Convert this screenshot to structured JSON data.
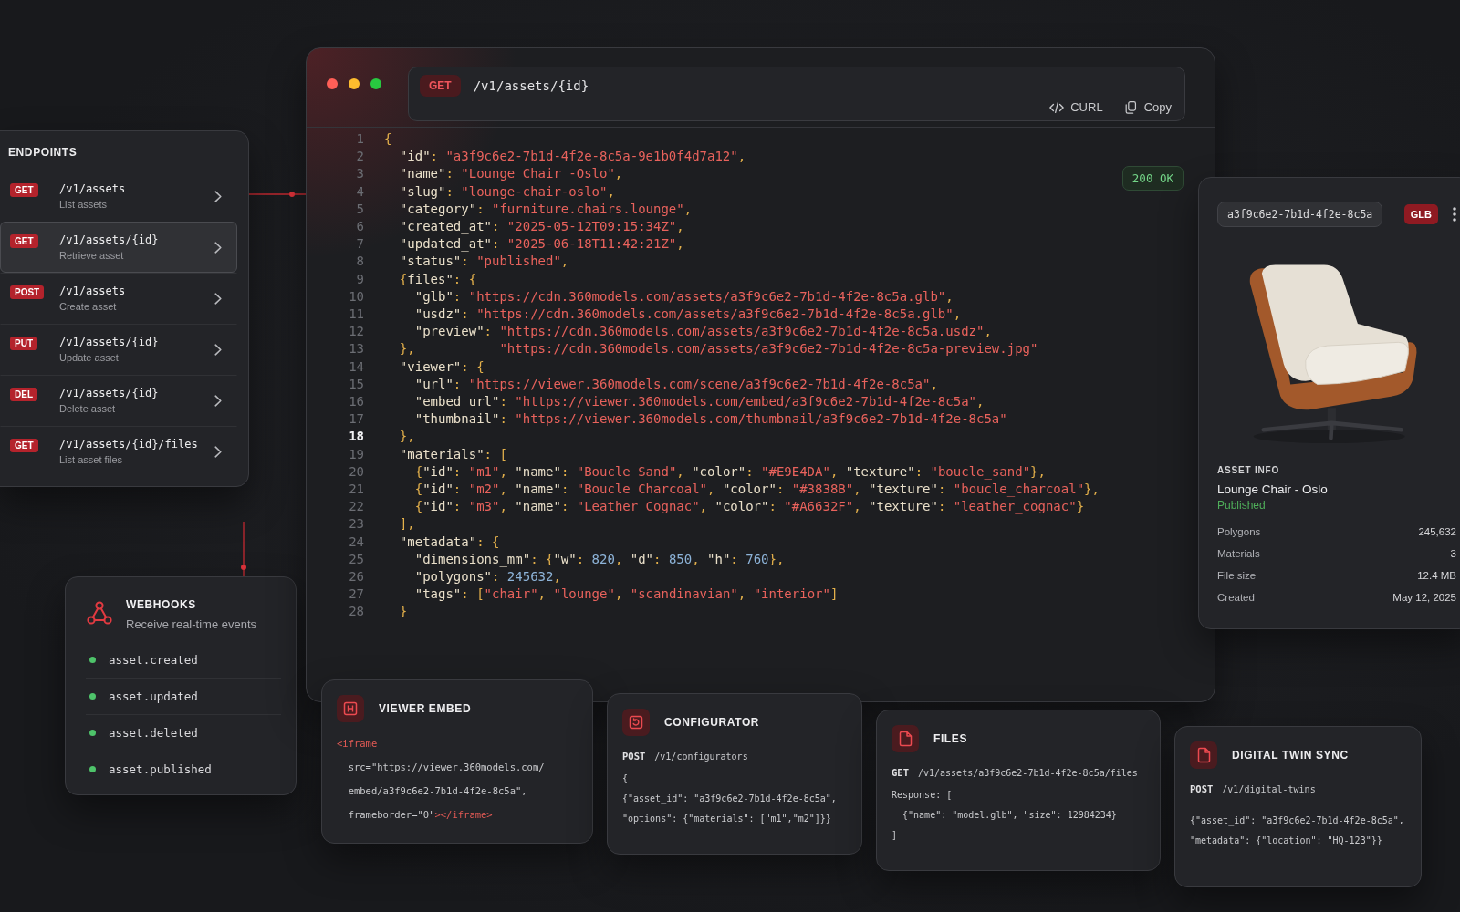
{
  "endpoints": {
    "title": "ENDPOINTS",
    "items": [
      {
        "method": "GET",
        "path": "/v1/assets",
        "description": "List assets",
        "selected": false
      },
      {
        "method": "GET",
        "path": "/v1/assets/{id}",
        "description": "Retrieve asset",
        "selected": true
      },
      {
        "method": "POST",
        "path": "/v1/assets",
        "description": "Create asset",
        "selected": false
      },
      {
        "method": "PUT",
        "path": "/v1/assets/{id}",
        "description": "Update asset",
        "selected": false
      },
      {
        "method": "DEL",
        "path": "/v1/assets/{id}",
        "description": "Delete asset",
        "selected": false
      },
      {
        "method": "GET",
        "path": "/v1/assets/{id}/files",
        "description": "List asset files",
        "selected": false
      }
    ]
  },
  "webhooks": {
    "title": "WEBHOOKS",
    "subtitle": "Receive real-time events",
    "events": [
      "asset.created",
      "asset.updated",
      "asset.deleted",
      "asset.published"
    ]
  },
  "request": {
    "method": "GET",
    "path": "/v1/assets/{id}",
    "actions": [
      {
        "kind": "curl",
        "label": "CURL"
      },
      {
        "kind": "copy",
        "label": "Copy"
      }
    ],
    "status": "200 OK",
    "lines": [
      {
        "number": "1",
        "selected": false,
        "tokens": [
          {
            "kind": "punct",
            "text": "{"
          }
        ],
        "children": [
          {
            "number": "2",
            "selected": false,
            "tokens": [
              {
                "kind": "key",
                "text": "\"id\""
              },
              {
                "kind": "punct",
                "text": ": "
              },
              {
                "kind": "string",
                "text": "\"a3f9c6e2-7b1d-4f2e-8c5a-9e1b0f4d7a12\""
              },
              {
                "kind": "punct",
                "text": ","
              }
            ]
          },
          {
            "number": "3",
            "selected": false,
            "tokens": [
              {
                "kind": "key",
                "text": "\"name\""
              },
              {
                "kind": "punct",
                "text": ": "
              },
              {
                "kind": "string",
                "text": "\"Lounge Chair -Oslo\""
              },
              {
                "kind": "punct",
                "text": ","
              }
            ]
          },
          {
            "number": "4",
            "selected": false,
            "tokens": [
              {
                "kind": "key",
                "text": "\"slug\""
              },
              {
                "kind": "punct",
                "text": ": "
              },
              {
                "kind": "string",
                "text": "\"lounge-chair-oslo\""
              },
              {
                "kind": "punct",
                "text": ","
              }
            ]
          },
          {
            "number": "5",
            "selected": false,
            "tokens": [
              {
                "kind": "key",
                "text": "\"category\""
              },
              {
                "kind": "punct",
                "text": ": "
              },
              {
                "kind": "string",
                "text": "\"furniture.chairs.lounge\""
              },
              {
                "kind": "punct",
                "text": ","
              }
            ]
          },
          {
            "number": "6",
            "selected": false,
            "tokens": [
              {
                "kind": "key",
                "text": "\"created_at\""
              },
              {
                "kind": "punct",
                "text": ": "
              },
              {
                "kind": "string",
                "text": "\"2025-05-12T09:15:34Z\""
              },
              {
                "kind": "punct",
                "text": ","
              }
            ]
          },
          {
            "number": "7",
            "selected": false,
            "tokens": [
              {
                "kind": "key",
                "text": "\"updated_at\""
              },
              {
                "kind": "punct",
                "text": ": "
              },
              {
                "kind": "string",
                "text": "\"2025-06-18T11:42:21Z\""
              },
              {
                "kind": "punct",
                "text": ","
              }
            ]
          },
          {
            "number": "8",
            "selected": false,
            "tokens": [
              {
                "kind": "key",
                "text": "\"status\""
              },
              {
                "kind": "punct",
                "text": ": "
              },
              {
                "kind": "string",
                "text": "\"published\""
              },
              {
                "kind": "punct",
                "text": ","
              }
            ]
          },
          {
            "number": "9",
            "selected": false,
            "tokens": [
              {
                "kind": "punct",
                "text": "{"
              },
              {
                "kind": "key",
                "text": "files\""
              },
              {
                "kind": "punct",
                "text": ": {"
              }
            ],
            "children": [
              {
                "number": "10",
                "selected": false,
                "tokens": [
                  {
                    "kind": "key",
                    "text": "\"glb\""
                  },
                  {
                    "kind": "punct",
                    "text": ": "
                  },
                  {
                    "kind": "string",
                    "text": "\"https://cdn.360models.com/assets/a3f9c6e2-7b1d-4f2e-8c5a.glb\""
                  },
                  {
                    "kind": "punct",
                    "text": ","
                  }
                ]
              },
              {
                "number": "11",
                "selected": false,
                "tokens": [
                  {
                    "kind": "key",
                    "text": "\"usdz\""
                  },
                  {
                    "kind": "punct",
                    "text": ": "
                  },
                  {
                    "kind": "string",
                    "text": "\"https://cdn.360models.com/assets/a3f9c6e2-7b1d-4f2e-8c5a.glb\""
                  },
                  {
                    "kind": "punct",
                    "text": ","
                  }
                ]
              },
              {
                "number": "12",
                "selected": false,
                "tokens": [
                  {
                    "kind": "key",
                    "text": "\"preview\""
                  },
                  {
                    "kind": "punct",
                    "text": ": "
                  },
                  {
                    "kind": "string",
                    "text": "\"https://cdn.360models.com/assets/a3f9c6e2-7b1d-4f2e-8c5a.usdz\""
                  },
                  {
                    "kind": "punct",
                    "text": ","
                  }
                ]
              }
            ]
          },
          {
            "number": "13",
            "selected": false,
            "tokens": [
              {
                "kind": "punct",
                "text": "},"
              },
              {
                "kind": "string",
                "text": "           \"https://cdn.360models.com/assets/a3f9c6e2-7b1d-4f2e-8c5a-preview.jpg\""
              }
            ]
          },
          {
            "number": "14",
            "selected": false,
            "tokens": [
              {
                "kind": "key",
                "text": "\"viewer\""
              },
              {
                "kind": "punct",
                "text": ": {"
              }
            ],
            "children": [
              {
                "number": "15",
                "selected": false,
                "tokens": [
                  {
                    "kind": "key",
                    "text": "\"url\""
                  },
                  {
                    "kind": "punct",
                    "text": ": "
                  },
                  {
                    "kind": "string",
                    "text": "\"https://viewer.360models.com/scene/a3f9c6e2-7b1d-4f2e-8c5a\""
                  },
                  {
                    "kind": "punct",
                    "text": ","
                  }
                ]
              },
              {
                "number": "16",
                "selected": false,
                "tokens": [
                  {
                    "kind": "key",
                    "text": "\"embed_url\""
                  },
                  {
                    "kind": "punct",
                    "text": ": "
                  },
                  {
                    "kind": "string",
                    "text": "\"https://viewer.360models.com/embed/a3f9c6e2-7b1d-4f2e-8c5a\""
                  },
                  {
                    "kind": "punct",
                    "text": ","
                  }
                ]
              },
              {
                "number": "17",
                "selected": false,
                "tokens": [
                  {
                    "kind": "key",
                    "text": "\"thumbnail\""
                  },
                  {
                    "kind": "punct",
                    "text": ": "
                  },
                  {
                    "kind": "string",
                    "text": "\"https://viewer.360models.com/thumbnail/a3f9c6e2-7b1d-4f2e-8c5a\""
                  }
                ]
              }
            ]
          },
          {
            "number": "18",
            "selected": true,
            "tokens": [
              {
                "kind": "punct",
                "text": "},"
              }
            ]
          },
          {
            "number": "19",
            "selected": false,
            "tokens": [
              {
                "kind": "key",
                "text": "\"materials\""
              },
              {
                "kind": "punct",
                "text": ": ["
              }
            ],
            "children": [
              {
                "number": "20",
                "selected": false,
                "tokens": [
                  {
                    "kind": "punct",
                    "text": "{"
                  },
                  {
                    "kind": "key",
                    "text": "\"id\""
                  },
                  {
                    "kind": "punct",
                    "text": ": "
                  },
                  {
                    "kind": "string",
                    "text": "\"m1\""
                  },
                  {
                    "kind": "punct",
                    "text": ", "
                  },
                  {
                    "kind": "key",
                    "text": "\"name\""
                  },
                  {
                    "kind": "punct",
                    "text": ": "
                  },
                  {
                    "kind": "string",
                    "text": "\"Boucle Sand\""
                  },
                  {
                    "kind": "punct",
                    "text": ", "
                  },
                  {
                    "kind": "key",
                    "text": "\"color\""
                  },
                  {
                    "kind": "punct",
                    "text": ": "
                  },
                  {
                    "kind": "string",
                    "text": "\"#E9E4DA\""
                  },
                  {
                    "kind": "punct",
                    "text": ", "
                  },
                  {
                    "kind": "key",
                    "text": "\"texture\""
                  },
                  {
                    "kind": "punct",
                    "text": ": "
                  },
                  {
                    "kind": "string",
                    "text": "\"boucle_sand\""
                  },
                  {
                    "kind": "punct",
                    "text": "},"
                  }
                ]
              },
              {
                "number": "21",
                "selected": false,
                "tokens": [
                  {
                    "kind": "punct",
                    "text": "{"
                  },
                  {
                    "kind": "key",
                    "text": "\"id\""
                  },
                  {
                    "kind": "punct",
                    "text": ": "
                  },
                  {
                    "kind": "string",
                    "text": "\"m2\""
                  },
                  {
                    "kind": "punct",
                    "text": ", "
                  },
                  {
                    "kind": "key",
                    "text": "\"name\""
                  },
                  {
                    "kind": "punct",
                    "text": ": "
                  },
                  {
                    "kind": "string",
                    "text": "\"Boucle Charcoal\""
                  },
                  {
                    "kind": "punct",
                    "text": ", "
                  },
                  {
                    "kind": "key",
                    "text": "\"color\""
                  },
                  {
                    "kind": "punct",
                    "text": ": "
                  },
                  {
                    "kind": "string",
                    "text": "\"#3838B\""
                  },
                  {
                    "kind": "punct",
                    "text": ", "
                  },
                  {
                    "kind": "key",
                    "text": "\"texture\""
                  },
                  {
                    "kind": "punct",
                    "text": ": "
                  },
                  {
                    "kind": "string",
                    "text": "\"boucle_charcoal\""
                  },
                  {
                    "kind": "punct",
                    "text": "},"
                  }
                ]
              },
              {
                "number": "22",
                "selected": false,
                "tokens": [
                  {
                    "kind": "punct",
                    "text": "{"
                  },
                  {
                    "kind": "key",
                    "text": "\"id\""
                  },
                  {
                    "kind": "punct",
                    "text": ": "
                  },
                  {
                    "kind": "string",
                    "text": "\"m3\""
                  },
                  {
                    "kind": "punct",
                    "text": ", "
                  },
                  {
                    "kind": "key",
                    "text": "\"name\""
                  },
                  {
                    "kind": "punct",
                    "text": ": "
                  },
                  {
                    "kind": "string",
                    "text": "\"Leather Cognac\""
                  },
                  {
                    "kind": "punct",
                    "text": ", "
                  },
                  {
                    "kind": "key",
                    "text": "\"color\""
                  },
                  {
                    "kind": "punct",
                    "text": ": "
                  },
                  {
                    "kind": "string",
                    "text": "\"#A6632F\""
                  },
                  {
                    "kind": "punct",
                    "text": ", "
                  },
                  {
                    "kind": "key",
                    "text": "\"texture\""
                  },
                  {
                    "kind": "punct",
                    "text": ": "
                  },
                  {
                    "kind": "string",
                    "text": "\"leather_cognac\""
                  },
                  {
                    "kind": "punct",
                    "text": "}"
                  }
                ]
              }
            ]
          },
          {
            "number": "23",
            "selected": false,
            "tokens": [
              {
                "kind": "punct",
                "text": "],"
              }
            ]
          },
          {
            "number": "24",
            "selected": false,
            "tokens": [
              {
                "kind": "key",
                "text": "\"metadata\""
              },
              {
                "kind": "punct",
                "text": ": {"
              }
            ],
            "children": [
              {
                "number": "25",
                "selected": false,
                "tokens": [
                  {
                    "kind": "key",
                    "text": "\"dimensions_mm\""
                  },
                  {
                    "kind": "punct",
                    "text": ": {"
                  },
                  {
                    "kind": "key",
                    "text": "\"w\""
                  },
                  {
                    "kind": "punct",
                    "text": ": "
                  },
                  {
                    "kind": "number",
                    "text": "820"
                  },
                  {
                    "kind": "punct",
                    "text": ", "
                  },
                  {
                    "kind": "key",
                    "text": "\"d\""
                  },
                  {
                    "kind": "punct",
                    "text": ": "
                  },
                  {
                    "kind": "number",
                    "text": "850"
                  },
                  {
                    "kind": "punct",
                    "text": ", "
                  },
                  {
                    "kind": "key",
                    "text": "\"h\""
                  },
                  {
                    "kind": "punct",
                    "text": ": "
                  },
                  {
                    "kind": "number",
                    "text": "760"
                  },
                  {
                    "kind": "punct",
                    "text": "},"
                  }
                ]
              },
              {
                "number": "26",
                "selected": false,
                "tokens": [
                  {
                    "kind": "key",
                    "text": "\"polygons\""
                  },
                  {
                    "kind": "punct",
                    "text": ": "
                  },
                  {
                    "kind": "number",
                    "text": "245632"
                  },
                  {
                    "kind": "punct",
                    "text": ","
                  }
                ]
              },
              {
                "number": "27",
                "selected": false,
                "tokens": [
                  {
                    "kind": "key",
                    "text": "\"tags\""
                  },
                  {
                    "kind": "punct",
                    "text": ": ["
                  },
                  {
                    "kind": "string",
                    "text": "\"chair\""
                  },
                  {
                    "kind": "punct",
                    "text": ", "
                  },
                  {
                    "kind": "string",
                    "text": "\"lounge\""
                  },
                  {
                    "kind": "punct",
                    "text": ", "
                  },
                  {
                    "kind": "string",
                    "text": "\"scandinavian\""
                  },
                  {
                    "kind": "punct",
                    "text": ", "
                  },
                  {
                    "kind": "string",
                    "text": "\"interior\""
                  },
                  {
                    "kind": "punct",
                    "text": "]"
                  }
                ]
              }
            ]
          },
          {
            "number": "28",
            "selected": false,
            "tokens": [
              {
                "kind": "punct",
                "text": "}"
              }
            ]
          }
        ]
      }
    ]
  },
  "asset": {
    "id": "a3f9c6e2-7b1d-4f2e-8c5a",
    "format": "GLB",
    "section": "ASSET INFO",
    "name": "Lounge Chair - Oslo",
    "status": "Published",
    "details": [
      {
        "label": "Polygons",
        "value": "245,632"
      },
      {
        "label": "Materials",
        "value": "3"
      },
      {
        "label": "File size",
        "value": "12.4 MB"
      },
      {
        "label": "Created",
        "value": "May 12, 2025"
      }
    ]
  },
  "cards": [
    {
      "kind": "embed",
      "title": "VIEWER EMBED",
      "lines": [
        {
          "tokens": [
            {
              "kind": "tag",
              "text": "<iframe"
            }
          ],
          "children": [
            {
              "tokens": [
                {
                  "kind": "text",
                  "text": "src=\"https://viewer.360models.com/"
                }
              ]
            },
            {
              "tokens": [
                {
                  "kind": "text",
                  "text": "embed/a3f9c6e2-7b1d-4f2e-8c5a\","
                }
              ]
            },
            {
              "tokens": [
                {
                  "kind": "text",
                  "text": "frameborder=\"0\""
                },
                {
                  "kind": "tag",
                  "text": "></iframe>"
                }
              ]
            }
          ]
        }
      ]
    },
    {
      "kind": "configurator",
      "title": "CONFIGURATOR",
      "method": "POST",
      "path": "/v1/configurators",
      "lines": [
        {
          "tokens": [
            {
              "kind": "text",
              "text": "{"
            }
          ]
        },
        {
          "tokens": [
            {
              "kind": "text",
              "text": "{\"asset_id\": \"a3f9c6e2-7b1d-4f2e-8c5a\","
            }
          ]
        },
        {
          "tokens": [
            {
              "kind": "text",
              "text": "\"options\": {\"materials\": [\"m1\",\"m2\"]}}"
            }
          ]
        }
      ]
    },
    {
      "kind": "files",
      "title": "FILES",
      "method": "GET",
      "path": "/v1/assets/a3f9c6e2-7b1d-4f2e-8c5a/files",
      "lines": [
        {
          "tokens": [
            {
              "kind": "text",
              "text": "Response: ["
            }
          ],
          "children": [
            {
              "tokens": [
                {
                  "kind": "text",
                  "text": "{\"name\": \"model.glb\", \"size\": 12984234}"
                }
              ]
            }
          ]
        },
        {
          "tokens": [
            {
              "kind": "text",
              "text": "]"
            }
          ]
        }
      ]
    },
    {
      "kind": "sync",
      "title": "DIGITAL TWIN SYNC",
      "method": "POST",
      "path": "/v1/digital-twins",
      "lines": [
        {
          "tokens": [
            {
              "kind": "text",
              "text": "{\"asset_id\": \"a3f9c6e2-7b1d-4f2e-8c5a\","
            }
          ]
        },
        {
          "tokens": [
            {
              "kind": "text",
              "text": "\"metadata\": {\"location\": \"HQ-123\"}}"
            }
          ]
        }
      ]
    }
  ]
}
